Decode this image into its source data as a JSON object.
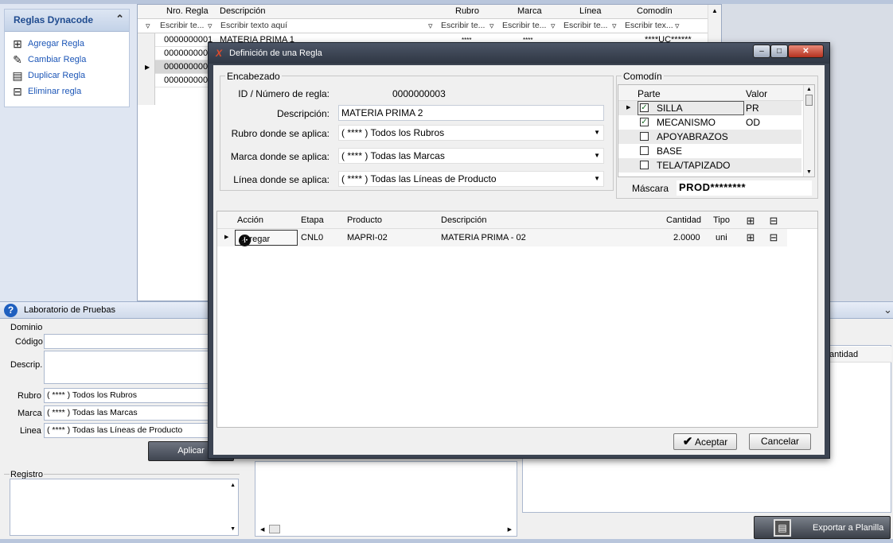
{
  "left_panel": {
    "title": "Reglas Dynacode",
    "items": [
      {
        "label": "Agregar Regla",
        "icon": "add-document-icon"
      },
      {
        "label": "Cambiar Regla",
        "icon": "edit-icon"
      },
      {
        "label": "Duplicar Regla",
        "icon": "duplicate-icon"
      },
      {
        "label": "Eliminar regla",
        "icon": "delete-document-icon"
      }
    ]
  },
  "grid": {
    "headers": {
      "nro": "Nro. Regla",
      "descripcion": "Descripción",
      "rubro": "Rubro",
      "marca": "Marca",
      "linea": "Línea",
      "comodin": "Comodín"
    },
    "filters": {
      "nro": "Escribir te...",
      "descripcion": "Escribir texto aquí",
      "rubro": "Escribir te...",
      "marca": "Escribir te...",
      "linea": "Escribir te...",
      "comodin": "Escribir tex..."
    },
    "rows": [
      {
        "nro": "0000000001",
        "descripcion": "MATERIA PRIMA 1",
        "rubro": "****",
        "marca": "****",
        "comodin": "****UC******"
      },
      {
        "nro": "0000000002"
      },
      {
        "nro": "0000000003"
      },
      {
        "nro": "0000000005"
      }
    ]
  },
  "lab": {
    "title": "Laboratorio de Pruebas",
    "dominio": "Dominio",
    "codigo_label": "Código",
    "descrip_label": "Descrip.",
    "rubro_label": "Rubro",
    "rubro_value": "( **** ) Todos los Rubros",
    "marca_label": "Marca",
    "marca_value": "( **** ) Todas las Marcas",
    "linea_label": "Linea",
    "linea_value": "( **** ) Todas las Líneas de Producto",
    "aplicar": "Aplicar",
    "registro": "Registro",
    "cantidad_header": "antidad",
    "exportar": "Exportar a Planilla"
  },
  "dialog": {
    "title": "Definición de una Regla",
    "encabezado": "Encabezado",
    "id_label": "ID / Número de regla:",
    "id_value": "0000000003",
    "desc_label": "Descripción:",
    "desc_value": "MATERIA PRIMA 2",
    "rubro_label": "Rubro donde se aplica:",
    "rubro_value": "( **** ) Todos los Rubros",
    "marca_label": "Marca donde se aplica:",
    "marca_value": "( **** ) Todas las Marcas",
    "linea_label": "Línea donde se aplica:",
    "linea_value": "( **** ) Todas las Líneas de Producto",
    "comodin": {
      "title": "Comodín",
      "col_parte": "Parte",
      "col_valor": "Valor",
      "rows": [
        {
          "parte": "SILLA",
          "valor": "PR",
          "checked": true
        },
        {
          "parte": "MECANISMO",
          "valor": "OD",
          "checked": true
        },
        {
          "parte": "APOYABRAZOS",
          "valor": "",
          "checked": false
        },
        {
          "parte": "BASE",
          "valor": "",
          "checked": false
        },
        {
          "parte": "TELA/TAPIZADO",
          "valor": "",
          "checked": false
        }
      ],
      "mascara_label": "Máscara",
      "mascara_value": "PROD********"
    },
    "acciones": {
      "headers": {
        "accion": "Acción",
        "etapa": "Etapa",
        "producto": "Producto",
        "descripcion": "Descripción",
        "cantidad": "Cantidad",
        "tipo": "Tipo"
      },
      "rows": [
        {
          "accion": "Agregar",
          "etapa": "CNL0",
          "producto": "MAPRI-02",
          "descripcion": "MATERIA PRIMA - 02",
          "cantidad": "2.0000",
          "tipo": "uni"
        }
      ]
    },
    "aceptar": "Aceptar",
    "cancelar": "Cancelar"
  }
}
